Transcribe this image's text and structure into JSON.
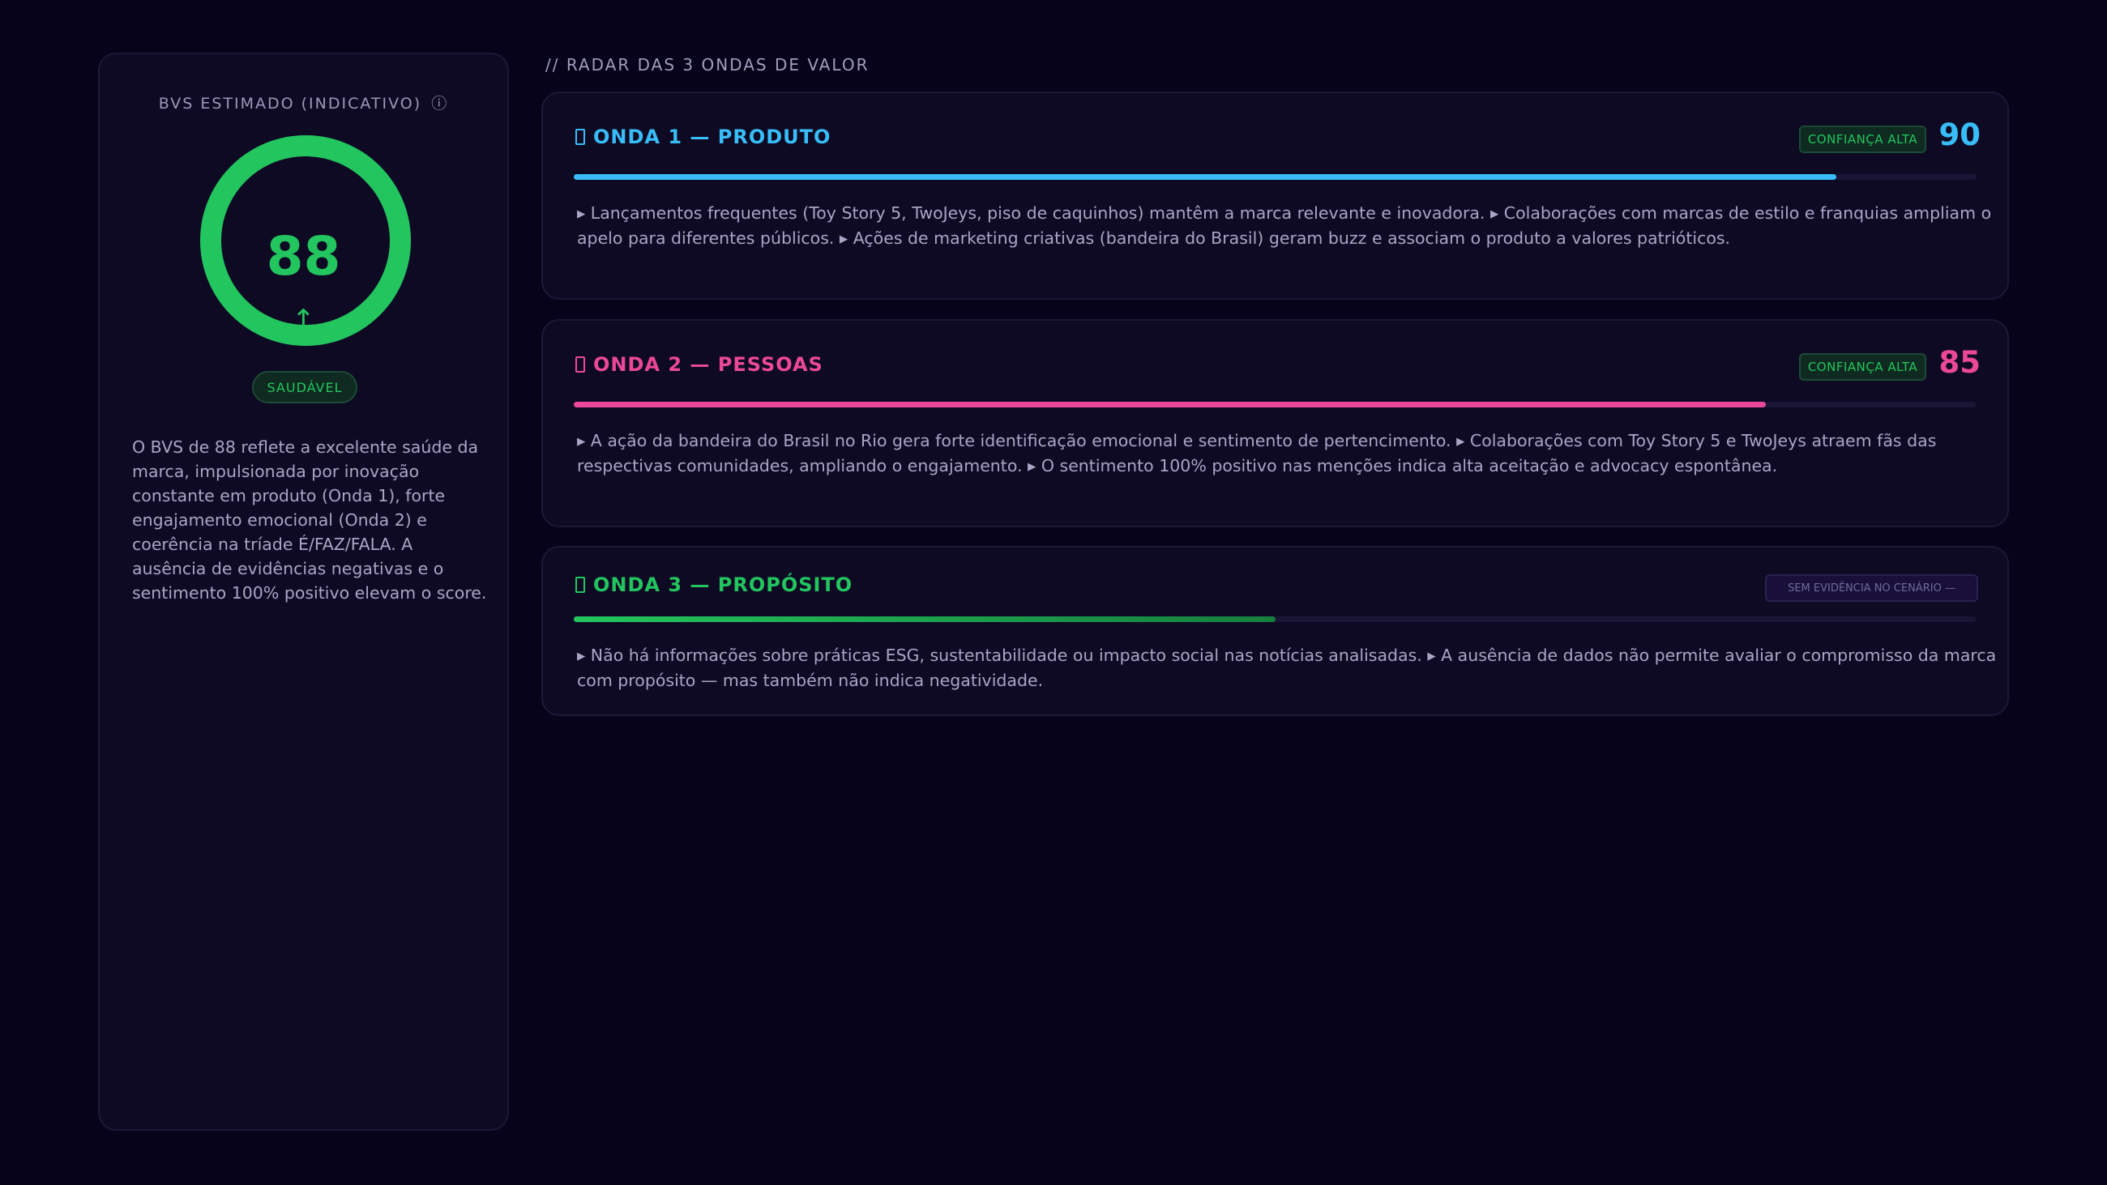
{
  "bvs": {
    "title": "BVS ESTIMADO (INDICATIVO)",
    "info_icon": "ⓘ",
    "score": "88",
    "score_fraction": 1.0,
    "trend_arrow": "↑",
    "status": "SAUDÁVEL",
    "color": "#22c55e",
    "summary": "O BVS de 88 reflete a excelente saúde da marca, impulsionada por inovação constante em produto (Onda 1), forte engajamento emocional (Onda 2) e coerência na tríade É/FAZ/FALA. A ausência de evidências negativas e o sentimento 100% positivo elevam o score."
  },
  "radar": {
    "section_title": "// RADAR DAS 3 ONDAS DE VALOR",
    "waves": [
      {
        "title": "ONDA 1 — PRODUTO",
        "color": "#38bdf8",
        "confidence": "CONFIANÇA ALTA",
        "score": "90",
        "bar_percent": 90,
        "text": "▸ Lançamentos frequentes (Toy Story 5, TwoJeys, piso de caquinhos) mantêm a marca relevante e inovadora. ▸ Colaborações com marcas de estilo e franquias ampliam o apelo para diferentes públicos. ▸ Ações de marketing criativas (bandeira do Brasil) geram buzz e associam o produto a valores patrióticos."
      },
      {
        "title": "ONDA 2 — PESSOAS",
        "color": "#ec4899",
        "confidence": "CONFIANÇA ALTA",
        "score": "85",
        "bar_percent": 85,
        "text": "▸ A ação da bandeira do Brasil no Rio gera forte identificação emocional e sentimento de pertencimento. ▸ Colaborações com Toy Story 5 e TwoJeys atraem fãs das respectivas comunidades, ampliando o engajamento. ▸ O sentimento 100% positivo nas menções indica alta aceitação e advocacy espontânea."
      },
      {
        "title": "ONDA 3 — PROPÓSITO",
        "color": "#22c55e",
        "badge": "SEM EVIDÊNCIA NO CENÁRIO —",
        "bar_percent": 50,
        "text": "▸ Não há informações sobre práticas ESG, sustentabilidade ou impacto social nas notícias analisadas. ▸ A ausência de dados não permite avaliar o compromisso da marca com propósito — mas também não indica negatividade."
      }
    ]
  }
}
